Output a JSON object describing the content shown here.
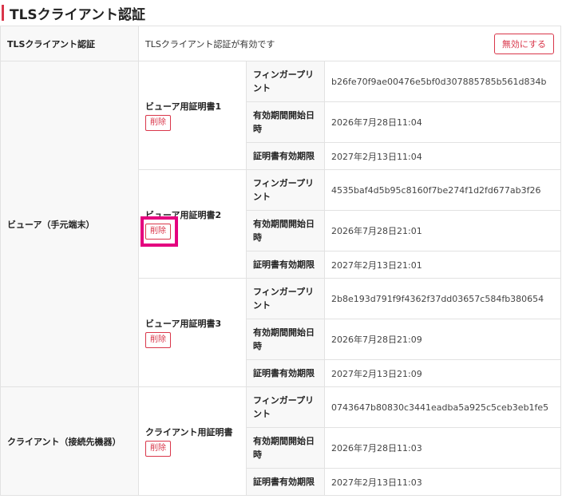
{
  "header": {
    "title": "TLSクライアント認証"
  },
  "status_row": {
    "label": "TLSクライアント認証",
    "value": "TLSクライアント認証が有効です",
    "disable_button": "無効にする"
  },
  "field_labels": {
    "fingerprint": "フィンガープリント",
    "valid_from": "有効期間開始日時",
    "valid_until": "証明書有効期限"
  },
  "delete_label": "削除",
  "groups": [
    {
      "label": "ビューア（手元端末）",
      "certs": [
        {
          "name": "ビューア用証明書1",
          "fingerprint": "b26fe70f9ae00476e5bf0d307885785b561d834b",
          "valid_from": "2026年7月28日11:04",
          "valid_until": "2027年2月13日11:04"
        },
        {
          "name": "ビューア用証明書2",
          "fingerprint": "4535baf4d5b95c8160f7be274f1d2fd677ab3f26",
          "valid_from": "2026年7月28日21:01",
          "valid_until": "2027年2月13日21:01"
        },
        {
          "name": "ビューア用証明書3",
          "fingerprint": "2b8e193d791f9f4362f37dd03657c584fb380654",
          "valid_from": "2026年7月28日21:09",
          "valid_until": "2027年2月13日21:09"
        }
      ]
    },
    {
      "label": "クライアント（接続先機器）",
      "certs": [
        {
          "name": "クライアント用証明書",
          "fingerprint": "0743647b80830c3441eadba5a925c5ceb3eb1fe5",
          "valid_from": "2026年7月28日11:03",
          "valid_until": "2027年2月13日11:03"
        }
      ]
    }
  ],
  "colors": {
    "accent": "#d9364a",
    "highlight": "#e4007f"
  }
}
